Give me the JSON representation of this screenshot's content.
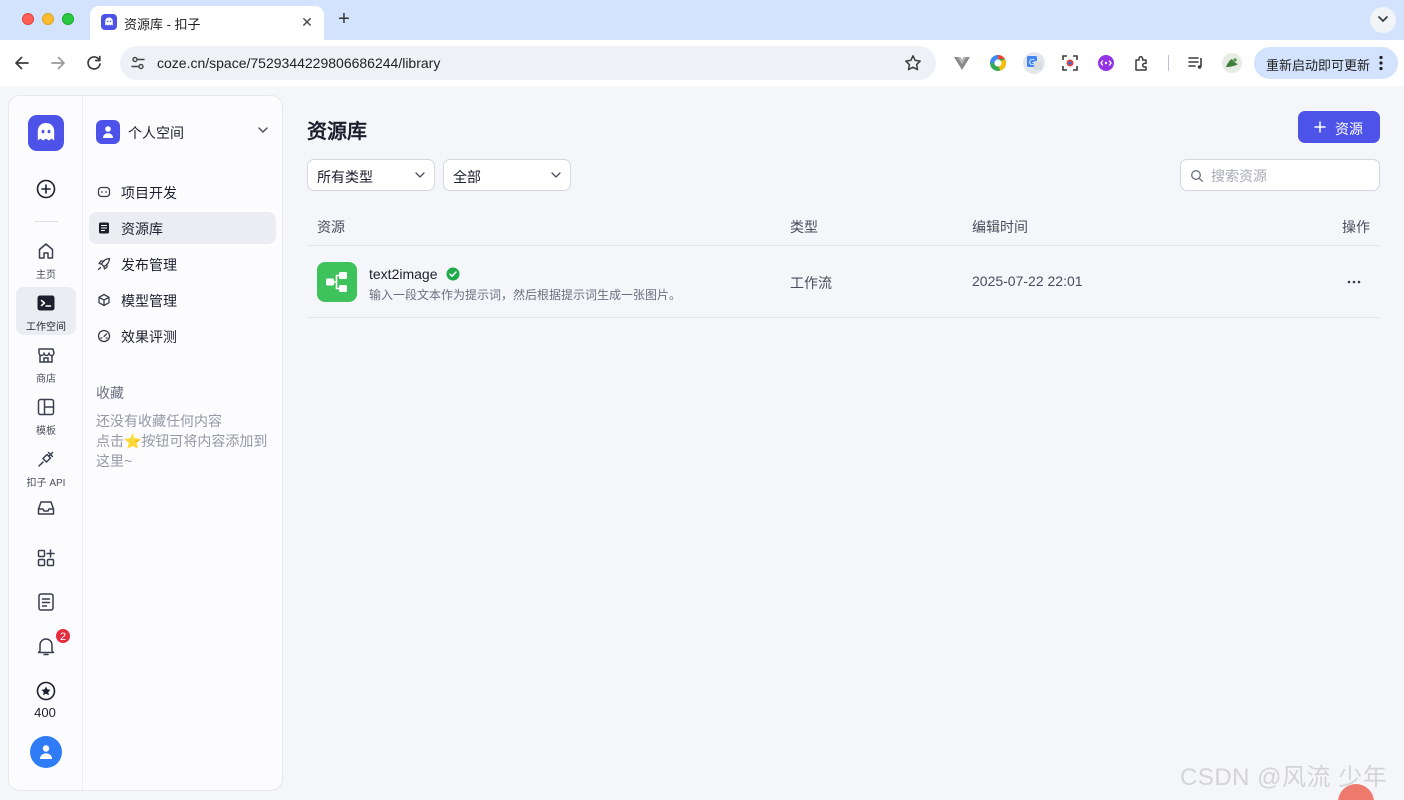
{
  "browser": {
    "tab_title": "资源库 - 扣子",
    "new_tab": "+",
    "url": "coze.cn/space/7529344229806686244/library",
    "update_label": "重新启动即可更新"
  },
  "rail": {
    "items": [
      {
        "label": "主页"
      },
      {
        "label": "工作空间"
      },
      {
        "label": "商店"
      },
      {
        "label": "模板"
      },
      {
        "label": "扣子 API"
      }
    ],
    "notification_count": "2",
    "points": "400"
  },
  "sidebar": {
    "space_name": "个人空间",
    "menu": [
      {
        "label": "项目开发"
      },
      {
        "label": "资源库"
      },
      {
        "label": "发布管理"
      },
      {
        "label": "模型管理"
      },
      {
        "label": "效果评测"
      }
    ],
    "favorites_title": "收藏",
    "favorites_empty": [
      "还没有收藏任何内容",
      "点击⭐按钮可将内容添加到这里~"
    ]
  },
  "main": {
    "title": "资源库",
    "add_button": "资源",
    "type_filter": "所有类型",
    "scope_filter": "全部",
    "search_placeholder": "搜索资源",
    "columns": [
      "资源",
      "类型",
      "编辑时间",
      "操作"
    ],
    "rows": [
      {
        "name": "text2image",
        "description": "输入一段文本作为提示词，然后根据提示词生成一张图片。",
        "type": "工作流",
        "edited": "2025-07-22 22:01"
      }
    ]
  },
  "watermark": "CSDN @风流 少年",
  "colors": {
    "accent": "#4d53e8",
    "workflow_icon": "#3ec25b",
    "badge": "#e52d3e",
    "verified": "#1faa4b"
  }
}
